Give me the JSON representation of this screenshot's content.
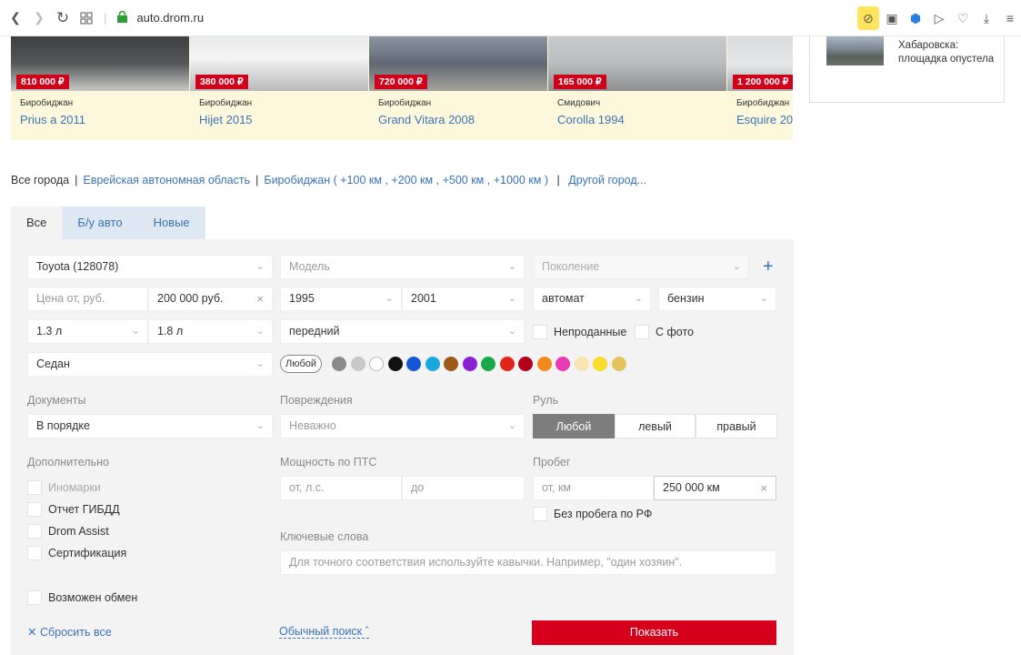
{
  "browser": {
    "url": "auto.drom.ru"
  },
  "cars": [
    {
      "price": "810 000 ₽",
      "city": "Биробиджан",
      "model": "Prius a 2011"
    },
    {
      "price": "380 000 ₽",
      "city": "Биробиджан",
      "model": "Hijet 2015"
    },
    {
      "price": "720 000 ₽",
      "city": "Биробиджан",
      "model": "Grand Vitara 2008"
    },
    {
      "price": "165 000 ₽",
      "city": "Смидович",
      "model": "Corolla 1994"
    },
    {
      "price": "1 200 000 ₽",
      "city": "Биробиджан",
      "model": "Esquire 20"
    }
  ],
  "side_news": {
    "line1": "Хабаровска:",
    "line2": "площадка опустела"
  },
  "citybar": {
    "all": "Все города",
    "region": "Еврейская автономная область",
    "city": "Биробиджан",
    "r100": "+100 км",
    "r200": "+200 км",
    "r500": "+500 км",
    "r1000": "+1000 км",
    "other": "Другой город..."
  },
  "tabs": [
    "Все",
    "Б/у авто",
    "Новые"
  ],
  "filters": {
    "brand": "Toyota (128078)",
    "model_placeholder": "Модель",
    "generation_placeholder": "Поколение",
    "price_from_placeholder": "Цена от, руб.",
    "price_to": "200 000 руб.",
    "year_from": "1995",
    "year_to": "2001",
    "transmission": "автомат",
    "fuel": "бензин",
    "engine_from": "1.3 л",
    "engine_to": "1.8 л",
    "drive": "передний",
    "unsold": "Непроданные",
    "with_photo": "С фото",
    "body": "Седан",
    "color_any": "Любой",
    "colors": [
      "#8a8a8a",
      "#c8c8c8",
      "#ffffff",
      "#111111",
      "#1357d6",
      "#1aa7e0",
      "#9b5a1a",
      "#8a1fd6",
      "#1aa84a",
      "#e0251b",
      "#b3001b",
      "#f08a1a",
      "#e83ab2",
      "#f7e3b0",
      "#f7dc2a",
      "#e3c35a"
    ],
    "documents_label": "Документы",
    "documents": "В порядке",
    "damage_label": "Повреждения",
    "damage": "Неважно",
    "wheel_label": "Руль",
    "wheel_options": [
      "Любой",
      "левый",
      "правый"
    ],
    "extra_label": "Дополнительно",
    "foreign": "Иномарки",
    "gibdd": "Отчет ГИБДД",
    "assist": "Drom Assist",
    "cert": "Сертификация",
    "exchange": "Возможен обмен",
    "power_label": "Мощность по ПТС",
    "power_from_placeholder": "от, л.с.",
    "power_to_placeholder": "до",
    "mileage_label": "Пробег",
    "mileage_from_placeholder": "от, км",
    "mileage_to": "250 000 км",
    "no_rf_mileage": "Без пробега по РФ",
    "keywords_label": "Ключевые слова",
    "keywords_placeholder": "Для точного соответствия используйте кавычки. Например, \"один хозяин\"."
  },
  "actions": {
    "reset": "Сбросить все",
    "simple_search": "Обычный поиск",
    "show": "Показать"
  }
}
